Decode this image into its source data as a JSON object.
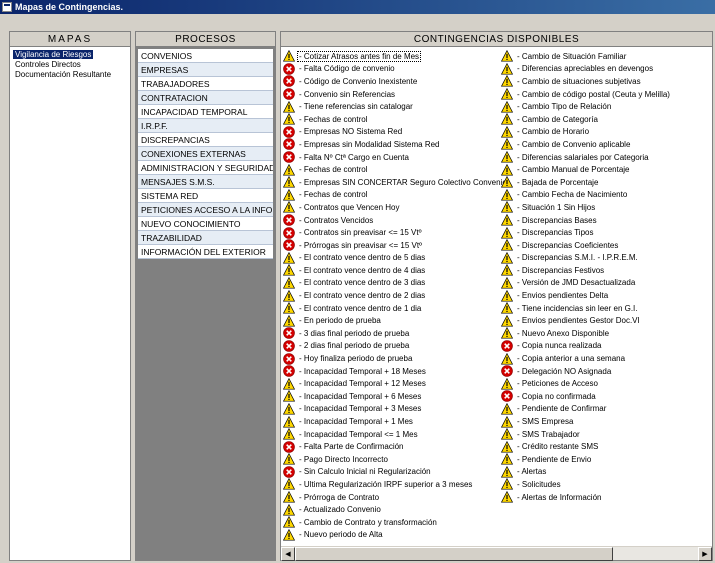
{
  "window": {
    "title": "Mapas de Contingencias."
  },
  "mapas": {
    "header": "MAPAS",
    "items": [
      "Vigilancia de Riesgos",
      "Controles Directos",
      "Documentación Resultante"
    ],
    "selected_index": 0
  },
  "procesos": {
    "header": "PROCESOS",
    "items": [
      "CONVENIOS",
      "EMPRESAS",
      "TRABAJADORES",
      "CONTRATACION",
      "INCAPACIDAD TEMPORAL",
      "I.R.P.F.",
      "DISCREPANCIAS",
      "CONEXIONES EXTERNAS",
      "ADMINISTRACION Y SEGURIDAD",
      "MENSAJES S.M.S.",
      "SISTEMA RED",
      "PETICIONES ACCESO A LA INFOR...",
      "NUEVO CONOCIMIENTO",
      "TRAZABILIDAD",
      "INFORMACIÓN DEL EXTERIOR"
    ]
  },
  "contingencias": {
    "header": "CONTINGENCIAS DISPONIBLES",
    "icons": {
      "w": "warning-icon",
      "e": "error-icon"
    },
    "colors": {
      "warning": "#ffd800",
      "error": "#d40000"
    },
    "column1": [
      {
        "label": "- Cotizar Atrasos antes fin de Mes",
        "icon": "w"
      },
      {
        "label": "- Falta Código de convenio",
        "icon": "e"
      },
      {
        "label": "- Código de Convenio Inexistente",
        "icon": "e"
      },
      {
        "label": "- Convenio sin Referencias",
        "icon": "e"
      },
      {
        "label": "- Tiene referencias sin catalogar",
        "icon": "w"
      },
      {
        "label": "- Fechas de control",
        "icon": "w"
      },
      {
        "label": "- Empresas NO Sistema Red",
        "icon": "e"
      },
      {
        "label": "- Empresas sin Modalidad Sistema Red",
        "icon": "e"
      },
      {
        "label": "- Falta Nº Ctª Cargo en Cuenta",
        "icon": "e"
      },
      {
        "label": "- Fechas de control",
        "icon": "w"
      },
      {
        "label": "- Empresas SIN CONCERTAR Seguro Colectivo Convenio",
        "icon": "w"
      },
      {
        "label": "- Fechas de control",
        "icon": "w"
      },
      {
        "label": "- Contratos que Vencen Hoy",
        "icon": "w"
      },
      {
        "label": "- Contratos Vencidos",
        "icon": "e"
      },
      {
        "label": "- Contratos sin preavisar <= 15 Vtº",
        "icon": "e"
      },
      {
        "label": "- Prórrogas sin preavisar <= 15 Vtº",
        "icon": "e"
      },
      {
        "label": "- El contrato vence dentro de 5 dias",
        "icon": "w"
      },
      {
        "label": "- El contrato vence dentro de 4 dias",
        "icon": "w"
      },
      {
        "label": "- El contrato vence dentro de 3 dias",
        "icon": "w"
      },
      {
        "label": "- El contrato vence dentro de 2 dias",
        "icon": "w"
      },
      {
        "label": "- El contrato vence dentro de 1 dia",
        "icon": "w"
      },
      {
        "label": "- En periodo de prueba",
        "icon": "w"
      },
      {
        "label": "- 3 dias final periodo de prueba",
        "icon": "e"
      },
      {
        "label": "- 2 dias final periodo de prueba",
        "icon": "e"
      },
      {
        "label": "- Hoy finaliza periodo de prueba",
        "icon": "e"
      },
      {
        "label": "- Incapacidad Temporal + 18 Meses",
        "icon": "e"
      },
      {
        "label": "- Incapacidad Temporal + 12 Meses",
        "icon": "w"
      },
      {
        "label": "- Incapacidad Temporal + 6 Meses",
        "icon": "w"
      },
      {
        "label": "- Incapacidad Temporal + 3 Meses",
        "icon": "w"
      },
      {
        "label": "- Incapacidad Temporal + 1 Mes",
        "icon": "w"
      },
      {
        "label": "- Incapacidad Temporal <= 1 Mes",
        "icon": "w"
      },
      {
        "label": "- Falta Parte de Confirmación",
        "icon": "e"
      },
      {
        "label": "- Pago Directo Incorrecto",
        "icon": "w"
      },
      {
        "label": "- Sin Calculo Inicial ni Regularización",
        "icon": "e"
      },
      {
        "label": "- Ultima Regularización IRPF superior a 3 meses",
        "icon": "w"
      },
      {
        "label": "- Prórroga de Contrato",
        "icon": "w"
      },
      {
        "label": "- Actualizado Convenio",
        "icon": "w"
      },
      {
        "label": "- Cambio de Contrato y transformación",
        "icon": "w"
      },
      {
        "label": "- Nuevo periodo de Alta",
        "icon": "w"
      }
    ],
    "column2": [
      {
        "label": "- Cambio de Situación Familiar",
        "icon": "w"
      },
      {
        "label": "- Diferencias apreciables en devengos",
        "icon": "w"
      },
      {
        "label": "- Cambio de situaciones subjetivas",
        "icon": "w"
      },
      {
        "label": "- Cambio de código postal (Ceuta y Melilla)",
        "icon": "w"
      },
      {
        "label": "- Cambio Tipo de Relación",
        "icon": "w"
      },
      {
        "label": "- Cambio de Categoría",
        "icon": "w"
      },
      {
        "label": "- Cambio de Horario",
        "icon": "w"
      },
      {
        "label": "- Cambio de Convenio aplicable",
        "icon": "w"
      },
      {
        "label": "- Diferencias salariales por Categoria",
        "icon": "w"
      },
      {
        "label": "- Cambio Manual de Porcentaje",
        "icon": "w"
      },
      {
        "label": "- Bajada de Porcentaje",
        "icon": "w"
      },
      {
        "label": "- Cambio Fecha de Nacimiento",
        "icon": "w"
      },
      {
        "label": "- Situación 1 Sin Hijos",
        "icon": "w"
      },
      {
        "label": "- Discrepancias Bases",
        "icon": "w"
      },
      {
        "label": "- Discrepancias Tipos",
        "icon": "w"
      },
      {
        "label": "- Discrepancias Coeficientes",
        "icon": "w"
      },
      {
        "label": "- Discrepancias S.M.I. - I.P.R.E.M.",
        "icon": "w"
      },
      {
        "label": "- Discrepancias Festivos",
        "icon": "w"
      },
      {
        "label": "- Versión de JMD Desactualizada",
        "icon": "w"
      },
      {
        "label": "- Envios pendientes Delta",
        "icon": "w"
      },
      {
        "label": "- Tiene incidencias sin leer en G.I.",
        "icon": "w"
      },
      {
        "label": "- Envios pendientes Gestor Doc.VI",
        "icon": "w"
      },
      {
        "label": "- Nuevo Anexo Disponible",
        "icon": "w"
      },
      {
        "label": "- Copia nunca realizada",
        "icon": "e"
      },
      {
        "label": "- Copia anterior a una semana",
        "icon": "w"
      },
      {
        "label": "- Delegación NO Asignada",
        "icon": "e"
      },
      {
        "label": "- Peticiones de Acceso",
        "icon": "w"
      },
      {
        "label": "- Copia no confirmada",
        "icon": "e"
      },
      {
        "label": "- Pendiente de Confirmar",
        "icon": "w"
      },
      {
        "label": "- SMS Empresa",
        "icon": "w"
      },
      {
        "label": "- SMS Trabajador",
        "icon": "w"
      },
      {
        "label": "- Crédito restante SMS",
        "icon": "w"
      },
      {
        "label": "- Pendiente de Envio",
        "icon": "w"
      },
      {
        "label": "- Alertas",
        "icon": "w"
      },
      {
        "label": "- Solicitudes",
        "icon": "w"
      },
      {
        "label": "- Alertas de Información",
        "icon": "w"
      }
    ]
  }
}
